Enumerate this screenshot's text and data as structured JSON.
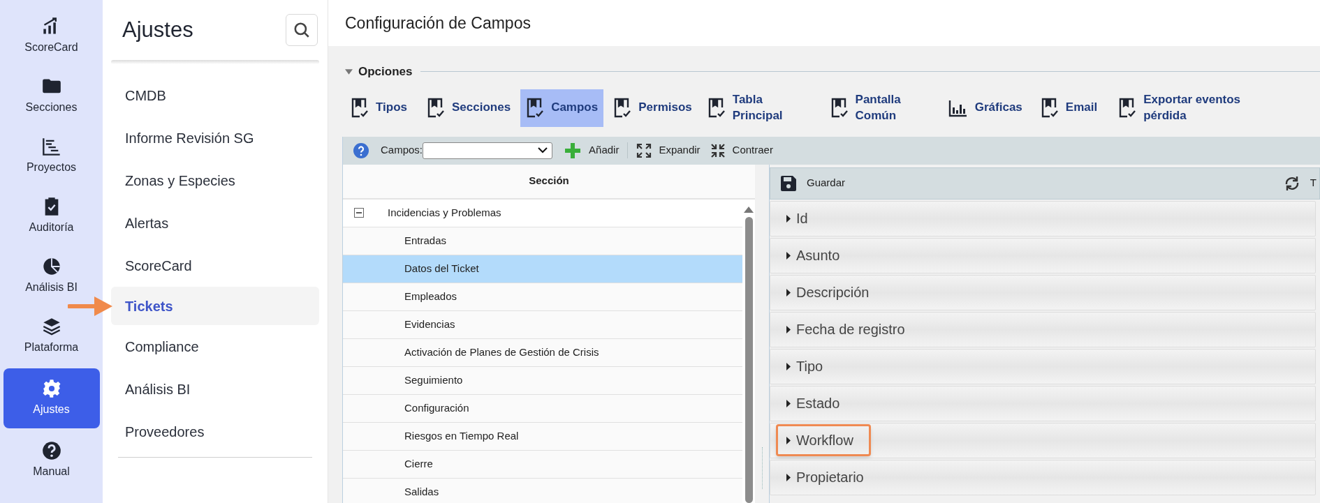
{
  "nav": [
    {
      "label": "ScoreCard",
      "kind": "chart",
      "selected": false
    },
    {
      "label": "Secciones",
      "kind": "folder",
      "selected": false
    },
    {
      "label": "Proyectos",
      "kind": "gantt",
      "selected": false
    },
    {
      "label": "Auditoría",
      "kind": "clipboard",
      "selected": false
    },
    {
      "label": "Análisis BI",
      "kind": "pie",
      "selected": false
    },
    {
      "label": "Plataforma",
      "kind": "layers",
      "selected": false
    },
    {
      "label": "Ajustes",
      "kind": "gear",
      "selected": true
    },
    {
      "label": "Manual",
      "kind": "help",
      "selected": false
    }
  ],
  "sidebar": {
    "title": "Ajustes",
    "items": [
      {
        "label": "CMDB",
        "selected": false,
        "arrow": false
      },
      {
        "label": "Informe Revisión SG",
        "selected": false,
        "arrow": false
      },
      {
        "label": "Zonas y Especies",
        "selected": false,
        "arrow": false
      },
      {
        "label": "Alertas",
        "selected": false,
        "arrow": false
      },
      {
        "label": "ScoreCard",
        "selected": false,
        "arrow": false
      },
      {
        "label": "Tickets",
        "selected": true,
        "arrow": true
      },
      {
        "label": "Compliance",
        "selected": false,
        "arrow": false
      },
      {
        "label": "Análisis BI",
        "selected": false,
        "arrow": false
      },
      {
        "label": "Proveedores",
        "selected": false,
        "arrow": false
      }
    ]
  },
  "page_title": "Configuración de Campos",
  "options": {
    "title": "Opciones",
    "buttons": [
      {
        "label": "Tipos",
        "kind": "bookmark",
        "selected": false
      },
      {
        "label": "Secciones",
        "kind": "bookmark",
        "selected": false
      },
      {
        "label": "Campos",
        "kind": "bookmark",
        "selected": true
      },
      {
        "label": "Permisos",
        "kind": "bookmark",
        "selected": false
      },
      {
        "label": "Tabla\nPrincipal",
        "kind": "bookmark",
        "selected": false
      },
      {
        "label": "Pantalla\nComún",
        "kind": "bookmark",
        "selected": false
      },
      {
        "label": "Gráficas",
        "kind": "bars",
        "selected": false
      },
      {
        "label": "Email",
        "kind": "bookmark",
        "selected": false
      },
      {
        "label": "Exportar eventos\npérdida",
        "kind": "bookmark",
        "selected": false
      }
    ]
  },
  "toolbar": {
    "select_label": "Campos:",
    "add": "Añadir",
    "expand": "Expandir",
    "collapse": "Contraer"
  },
  "tree": {
    "column": "Sección",
    "root": {
      "label": "Incidencias y Problemas",
      "expanded": true,
      "children": [
        {
          "label": "Entradas",
          "selected": false
        },
        {
          "label": "Datos del Ticket",
          "selected": true
        },
        {
          "label": "Empleados",
          "selected": false
        },
        {
          "label": "Evidencias",
          "selected": false
        },
        {
          "label": "Activación de Planes de Gestión de Crisis",
          "selected": false
        },
        {
          "label": "Seguimiento",
          "selected": false
        },
        {
          "label": "Configuración",
          "selected": false
        },
        {
          "label": "Riesgos en Tiempo Real",
          "selected": false
        },
        {
          "label": "Cierre",
          "selected": false
        },
        {
          "label": "Salidas",
          "selected": false
        }
      ]
    }
  },
  "fields_panel": {
    "save": "Guardar",
    "right_label": "T",
    "fields": [
      {
        "label": "Id",
        "highlighted": false
      },
      {
        "label": "Asunto",
        "highlighted": false
      },
      {
        "label": "Descripción",
        "highlighted": false
      },
      {
        "label": "Fecha de registro",
        "highlighted": false
      },
      {
        "label": "Tipo",
        "highlighted": false
      },
      {
        "label": "Estado",
        "highlighted": false
      },
      {
        "label": "Workflow",
        "highlighted": true
      },
      {
        "label": "Propietario",
        "highlighted": false
      }
    ]
  }
}
